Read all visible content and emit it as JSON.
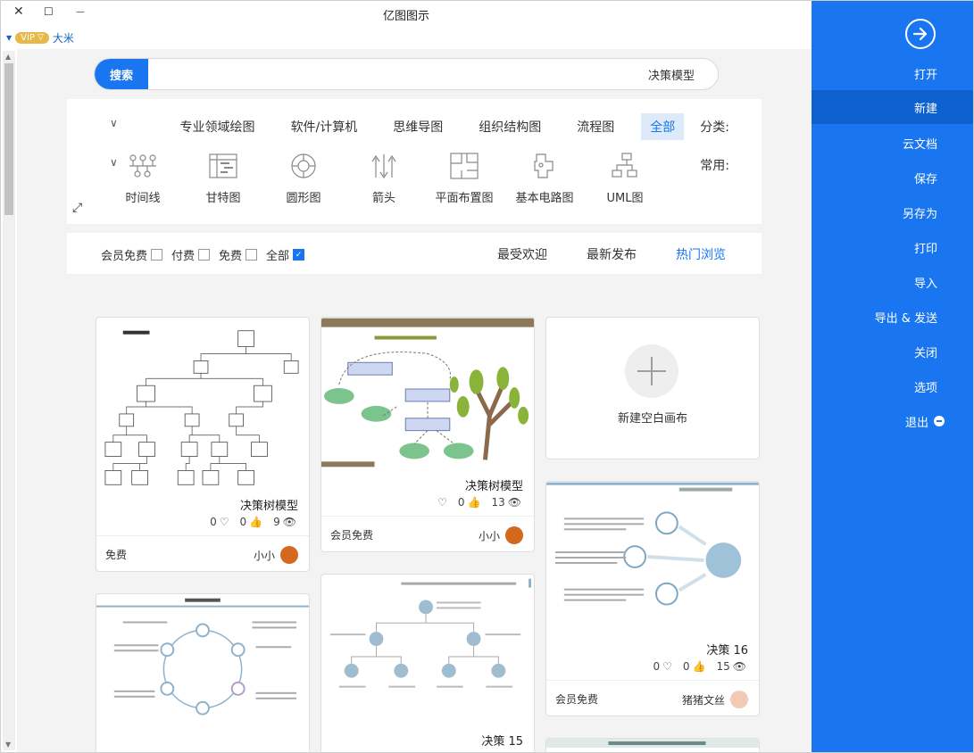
{
  "window": {
    "title": "亿图图示",
    "close": "✕",
    "maximize": "☐",
    "minimize": "—"
  },
  "user": {
    "vip": "VIP",
    "name": "大米"
  },
  "search": {
    "button": "搜索",
    "value": "决策模型"
  },
  "categories": {
    "label": "分类:",
    "items": [
      "全部",
      "流程图",
      "组织结构图",
      "思维导图",
      "软件/计算机",
      "专业领域绘图"
    ],
    "active": "全部"
  },
  "common": {
    "label": "常用:",
    "items": [
      "UML图",
      "基本电路图",
      "平面布置图",
      "箭头",
      "圆形图",
      "甘特图",
      "时间线"
    ]
  },
  "filters": {
    "tabs": [
      "热门浏览",
      "最新发布",
      "最受欢迎"
    ],
    "active_tab": "热门浏览",
    "checks": [
      {
        "label": "全部",
        "checked": true
      },
      {
        "label": "免费",
        "checked": false
      },
      {
        "label": "付费",
        "checked": false
      },
      {
        "label": "会员免费",
        "checked": false
      }
    ]
  },
  "new_canvas": {
    "label": "新建空白画布"
  },
  "cards": [
    {
      "title": "决策树模型",
      "views": "13",
      "likes": "0",
      "favs": "",
      "author": "小小",
      "price": "会员免费"
    },
    {
      "title": "决策树模型",
      "views": "9",
      "likes": "0",
      "favs": "0",
      "author": "小小",
      "price": "免费"
    },
    {
      "title": "决策 16",
      "views": "15",
      "likes": "0",
      "favs": "0",
      "author": "猪猪文丝",
      "price": "会员免费"
    },
    {
      "title": "决策 15",
      "views": "",
      "likes": "",
      "favs": "",
      "author": "",
      "price": ""
    },
    {
      "title": "",
      "views": "",
      "likes": "",
      "favs": "",
      "author": "",
      "price": ""
    }
  ],
  "sidebar": {
    "items": [
      "打开",
      "新建",
      "云文档",
      "保存",
      "另存为",
      "打印",
      "导入",
      "导出 & 发送",
      "关闭",
      "选项",
      "退出"
    ],
    "active": "新建"
  },
  "colors": {
    "accent": "#1976f0",
    "sidebar": "#1976f0",
    "vip": "#e8b948"
  }
}
